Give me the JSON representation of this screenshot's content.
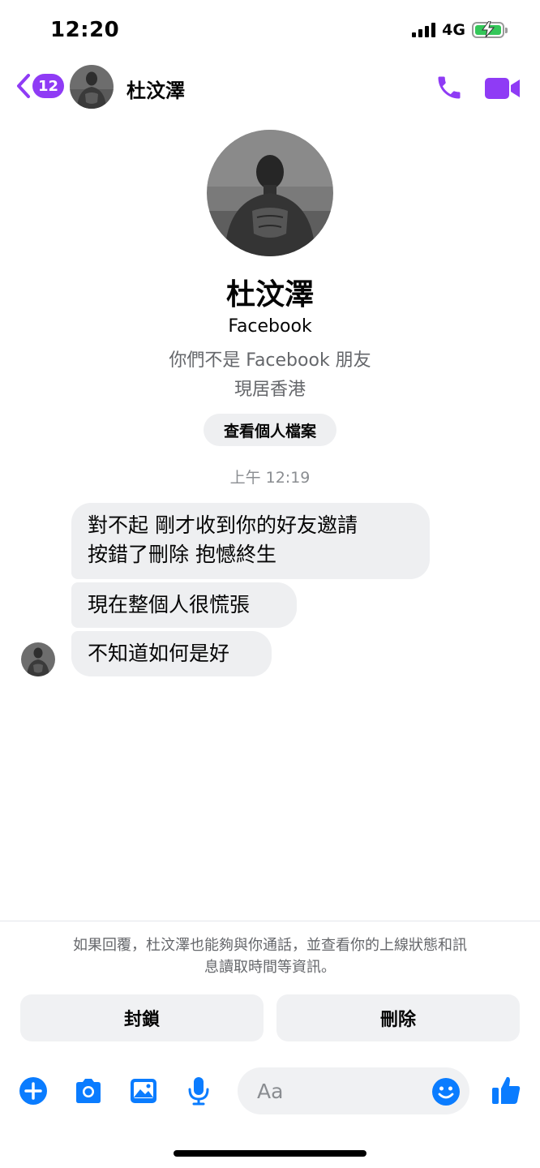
{
  "status_bar": {
    "time": "12:20",
    "network": "4G"
  },
  "header": {
    "back_badge": "12",
    "contact_name": "杜汶澤"
  },
  "profile": {
    "name": "杜汶澤",
    "source": "Facebook",
    "friend_status": "你們不是 Facebook 朋友",
    "location": "現居香港",
    "view_profile_label": "查看個人檔案"
  },
  "conversation": {
    "timestamp": "上午 12:19",
    "messages": [
      {
        "line1": "對不起 剛才收到你的好友邀請",
        "line2": "按錯了刪除 抱憾終生"
      },
      {
        "line1": "現在整個人很慌張"
      },
      {
        "line1": "不知道如何是好"
      }
    ]
  },
  "request_notice": {
    "line1": "如果回覆，杜汶澤也能夠與你通話，並查看你的上線狀態和訊",
    "line2": "息讀取時間等資訊。"
  },
  "actions": {
    "block_label": "封鎖",
    "delete_label": "刪除"
  },
  "composer": {
    "placeholder": "Aa"
  },
  "colors": {
    "accent": "#8f3bf5",
    "composer_blue": "#0a7cff",
    "bubble_bg": "#eeeff1",
    "battery": "#34c759"
  }
}
